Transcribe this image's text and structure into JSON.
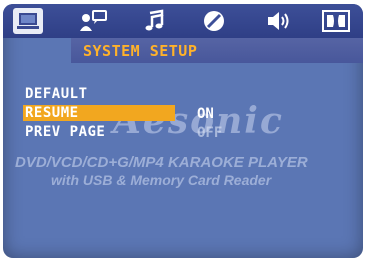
{
  "tabs": [
    {
      "icon": "monitor-icon",
      "active": true
    },
    {
      "icon": "person-speech-icon",
      "active": false
    },
    {
      "icon": "music-note-icon",
      "active": false
    },
    {
      "icon": "disc-icon",
      "active": false
    },
    {
      "icon": "speaker-icon",
      "active": false
    },
    {
      "icon": "dolby-icon",
      "active": false
    }
  ],
  "section_title": "SYSTEM SETUP",
  "menu": {
    "items": [
      {
        "label": "DEFAULT",
        "selected": false
      },
      {
        "label": "RESUME",
        "selected": true,
        "value": "ON"
      },
      {
        "label": "PREV PAGE",
        "selected": false,
        "value": "OFF"
      }
    ]
  },
  "watermark": {
    "brand": "Aesonic",
    "line1": "DVD/VCD/CD+G/MP4 KARAOKE PLAYER",
    "line2": "with USB & Memory Card Reader"
  },
  "colors": {
    "background": "#5b76b4",
    "highlight": "#f2a71f",
    "title": "#ffb22a"
  }
}
